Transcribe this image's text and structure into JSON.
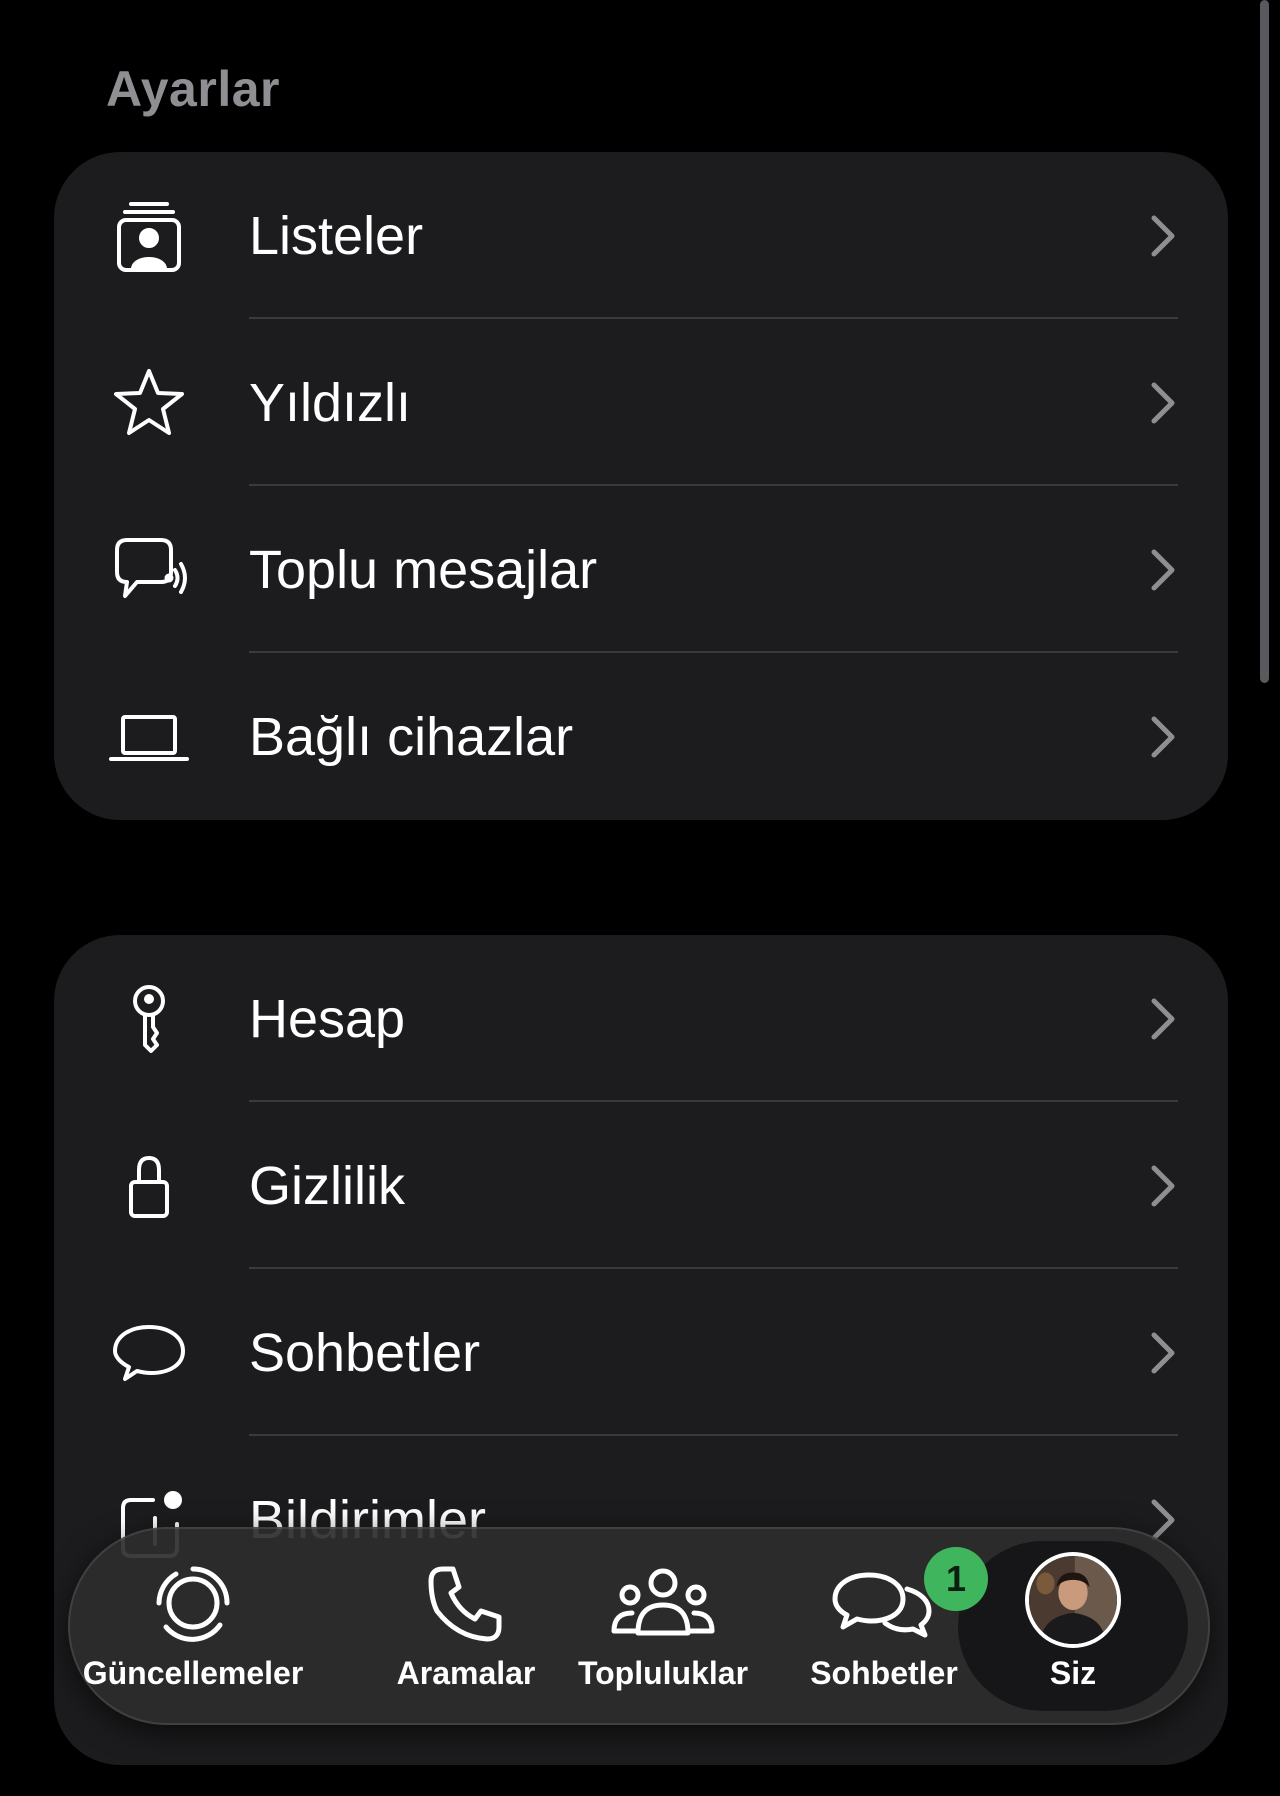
{
  "page_title": "Ayarlar",
  "colors": {
    "background": "#000000",
    "card": "#1c1c1e",
    "divider": "#3a3a3c",
    "title_gray": "#8e8e93",
    "badge_green": "#3fb55e"
  },
  "group1": {
    "items": [
      {
        "label": "Listeler",
        "icon": "lists-icon"
      },
      {
        "label": "Yıldızlı",
        "icon": "star-icon"
      },
      {
        "label": "Toplu mesajlar",
        "icon": "broadcast-icon"
      },
      {
        "label": "Bağlı cihazlar",
        "icon": "laptop-icon"
      }
    ]
  },
  "group2": {
    "items": [
      {
        "label": "Hesap",
        "icon": "key-icon"
      },
      {
        "label": "Gizlilik",
        "icon": "lock-icon"
      },
      {
        "label": "Sohbetler",
        "icon": "chat-bubble-icon"
      },
      {
        "label": "Bildirimler",
        "icon": "notification-icon"
      }
    ]
  },
  "tabbar": {
    "tabs": [
      {
        "label": "Güncellemeler",
        "icon": "updates-icon"
      },
      {
        "label": "Aramalar",
        "icon": "phone-icon"
      },
      {
        "label": "Topluluklar",
        "icon": "communities-icon"
      },
      {
        "label": "Sohbetler",
        "icon": "chats-icon",
        "badge": "1"
      },
      {
        "label": "Siz",
        "icon": "avatar",
        "selected": true
      }
    ]
  }
}
